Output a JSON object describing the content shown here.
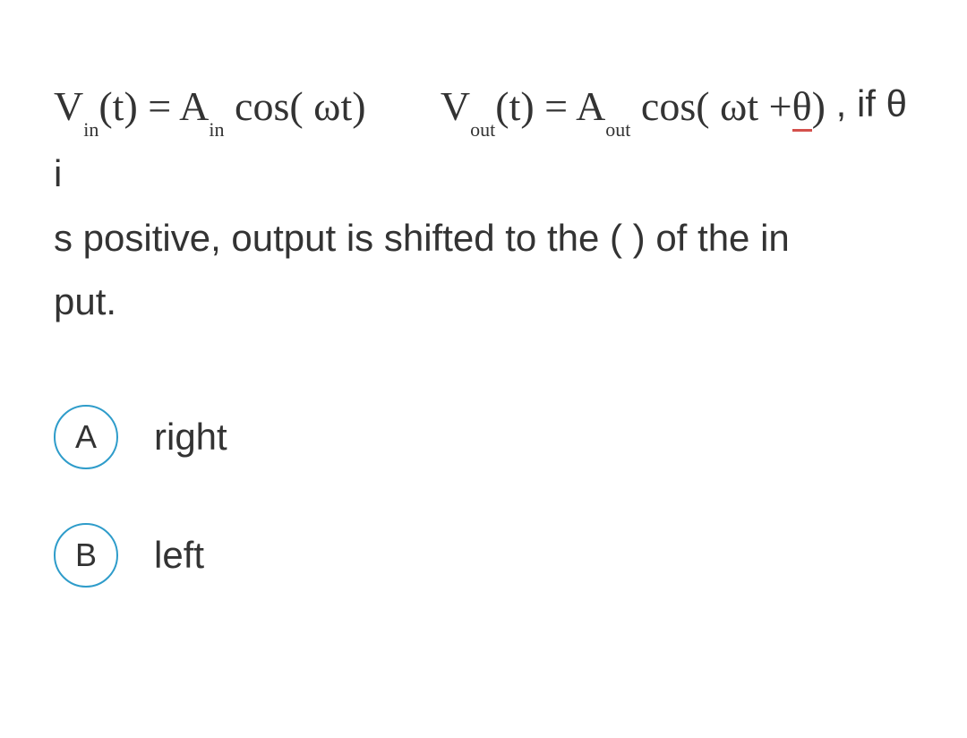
{
  "question": {
    "formula1": {
      "var1": "V",
      "sub1": "in",
      "func": "(t) = A",
      "sub2": "in",
      "rest": " cos( ωt)"
    },
    "formula2": {
      "var1": "V",
      "sub1": "out",
      "func": "(t) = A",
      "sub2": "out",
      "rest1": " cos( ωt +",
      "theta": "θ",
      "rest2": ")"
    },
    "text_after": " , if θ i",
    "text_line2": "s positive, output is shifted to the (  ) of the in",
    "text_line3": "put."
  },
  "options": [
    {
      "letter": "A",
      "label": "right"
    },
    {
      "letter": "B",
      "label": "left"
    }
  ]
}
